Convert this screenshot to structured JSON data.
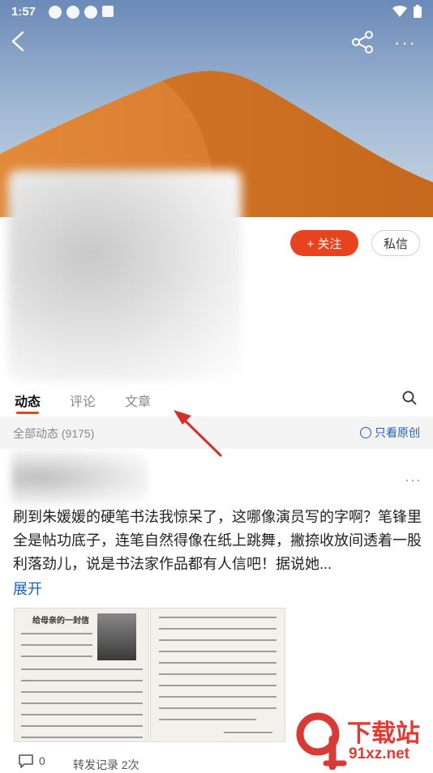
{
  "status_bar": {
    "time": "1:57"
  },
  "profile": {
    "follow_label": "+ 关注",
    "message_label": "私信"
  },
  "tabs": [
    {
      "label": "动态",
      "active": true
    },
    {
      "label": "评论",
      "active": false
    },
    {
      "label": "文章",
      "active": false
    }
  ],
  "filter": {
    "count_label": "全部动态 (9175)",
    "original_only_label": "只看原创"
  },
  "post": {
    "text": "刷到朱媛媛的硬笔书法我惊呆了，这哪像演员写的字啊？笔锋里全是帖功底子，连笔自然得像在纸上跳舞，撇捺收放间透着一股利落劲儿，说是书法家作品都有人信吧！据说她...",
    "expand_label": "展开",
    "image1_title": "给母亲的一封信",
    "comment_count": "0",
    "forward_label": "转发记录 2次"
  },
  "watermark": {
    "brand": "下载站",
    "site": "91xz.net"
  },
  "colors": {
    "accent": "#e8421f",
    "link": "#1e5fbf"
  }
}
